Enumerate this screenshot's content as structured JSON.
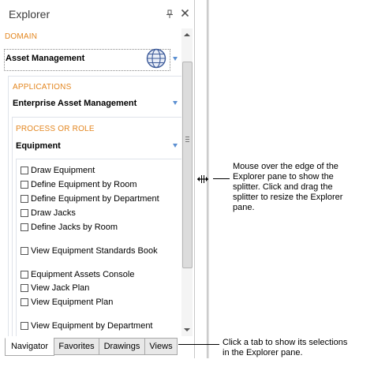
{
  "pane": {
    "title": "Explorer",
    "pin_icon": "pin-icon",
    "close_icon": "close-icon"
  },
  "domain": {
    "label": "DOMAIN",
    "value": "Asset Management",
    "icon": "globe-icon"
  },
  "applications": {
    "label": "APPLICATIONS",
    "value": "Enterprise Asset Management"
  },
  "process": {
    "label": "PROCESS OR ROLE",
    "value": "Equipment"
  },
  "tasks": [
    "Draw Equipment",
    "Define Equipment by Room",
    "Define Equipment by Department",
    "Draw Jacks",
    "Define Jacks by Room",
    "View Equipment Standards Book",
    "Equipment Assets Console",
    "View Jack Plan",
    "View Equipment Plan",
    "View Equipment by Department"
  ],
  "tabs": [
    "Navigator",
    "Favorites",
    "Drawings",
    "Views"
  ],
  "active_tab": "Navigator",
  "callouts": {
    "splitter": [
      "Mouse over the edge of the",
      "Explorer pane to show the",
      "splitter. Click and drag the",
      "splitter to resize the Explorer",
      "pane."
    ],
    "tabs": [
      "Click a tab to show its selections",
      "in the Explorer pane."
    ]
  },
  "colors": {
    "section_label": "#e3861f",
    "caret": "#5b8fd1"
  }
}
